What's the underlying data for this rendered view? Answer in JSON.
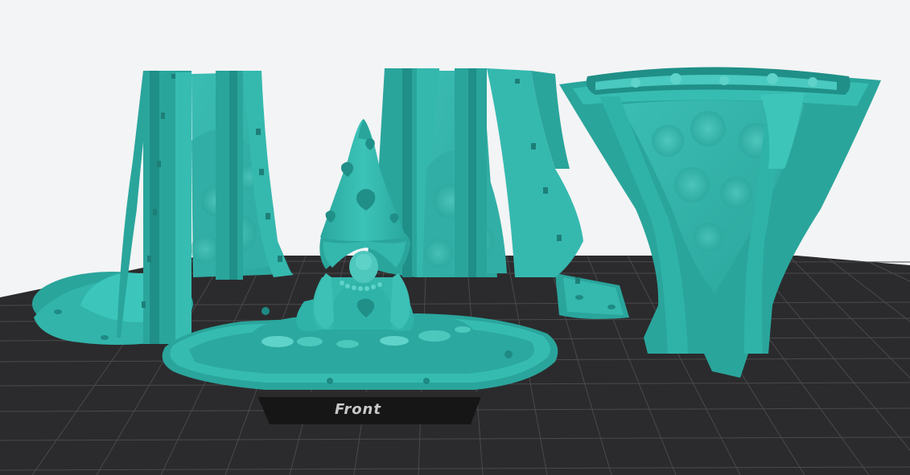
{
  "scene": {
    "plate_label": "Front",
    "colors": {
      "background": "#f3f4f5",
      "build_plate": "#2b2b2d",
      "grid_line": "#4a4a4d",
      "model_base": "#2fb8ae",
      "model_dark": "#1f8f87",
      "model_light": "#5fd3c9",
      "label_tab": "#1a1a1a",
      "label_text": "#c9c9c9"
    },
    "objects": [
      "mold-half-left",
      "gnome-master-on-base",
      "mold-half-center",
      "mold-funnel-right"
    ]
  }
}
